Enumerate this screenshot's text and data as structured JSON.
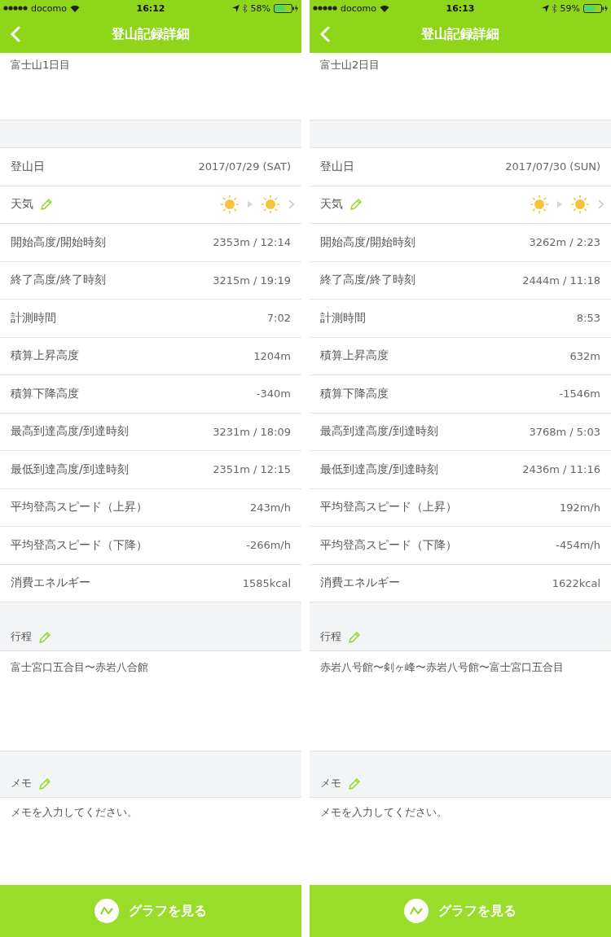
{
  "screens": [
    {
      "status_bar": {
        "carrier": "docomo",
        "time": "16:12",
        "battery": "58%"
      },
      "title": "登山記録詳細",
      "record_name": "富士山1日目",
      "rows": [
        {
          "kind": "text",
          "label": "登山日",
          "value": "2017/07/29 (SAT)"
        },
        {
          "kind": "weather",
          "label": "天気"
        },
        {
          "kind": "text",
          "label": "開始高度/開始時刻",
          "value": "2353m / 12:14"
        },
        {
          "kind": "text",
          "label": "終了高度/終了時刻",
          "value": "3215m / 19:19"
        },
        {
          "kind": "text",
          "label": "計測時間",
          "value": "7:02"
        },
        {
          "kind": "text",
          "label": "積算上昇高度",
          "value": "1204m"
        },
        {
          "kind": "text",
          "label": "積算下降高度",
          "value": "-340m"
        },
        {
          "kind": "text",
          "label": "最高到達高度/到達時刻",
          "value": "3231m / 18:09"
        },
        {
          "kind": "text",
          "label": "最低到達高度/到達時刻",
          "value": "2351m / 12:15"
        },
        {
          "kind": "text",
          "label": "平均登高スピード（上昇）",
          "value": "243m/h"
        },
        {
          "kind": "text",
          "label": "平均登高スピード（下降）",
          "value": "-266m/h"
        },
        {
          "kind": "text",
          "label": "消費エネルギー",
          "value": "1585kcal"
        }
      ],
      "route": {
        "label": "行程",
        "text": "富士宮口五合目〜赤岩八合館"
      },
      "memo": {
        "label": "メモ",
        "placeholder": "メモを入力してください。"
      },
      "graph_button": "グラフを見る"
    },
    {
      "status_bar": {
        "carrier": "docomo",
        "time": "16:13",
        "battery": "59%"
      },
      "title": "登山記録詳細",
      "record_name": "富士山2日目",
      "rows": [
        {
          "kind": "text",
          "label": "登山日",
          "value": "2017/07/30 (SUN)"
        },
        {
          "kind": "weather",
          "label": "天気"
        },
        {
          "kind": "text",
          "label": "開始高度/開始時刻",
          "value": "3262m / 2:23"
        },
        {
          "kind": "text",
          "label": "終了高度/終了時刻",
          "value": "2444m / 11:18"
        },
        {
          "kind": "text",
          "label": "計測時間",
          "value": "8:53"
        },
        {
          "kind": "text",
          "label": "積算上昇高度",
          "value": "632m"
        },
        {
          "kind": "text",
          "label": "積算下降高度",
          "value": "-1546m"
        },
        {
          "kind": "text",
          "label": "最高到達高度/到達時刻",
          "value": "3768m / 5:03"
        },
        {
          "kind": "text",
          "label": "最低到達高度/到達時刻",
          "value": "2436m / 11:16"
        },
        {
          "kind": "text",
          "label": "平均登高スピード（上昇）",
          "value": "192m/h"
        },
        {
          "kind": "text",
          "label": "平均登高スピード（下降）",
          "value": "-454m/h"
        },
        {
          "kind": "text",
          "label": "消費エネルギー",
          "value": "1622kcal"
        }
      ],
      "route": {
        "label": "行程",
        "text": "赤岩八号館〜剣ヶ峰〜赤岩八号館〜富士宮口五合目"
      },
      "memo": {
        "label": "メモ",
        "placeholder": "メモを入力してください。"
      },
      "graph_button": "グラフを見る"
    }
  ]
}
